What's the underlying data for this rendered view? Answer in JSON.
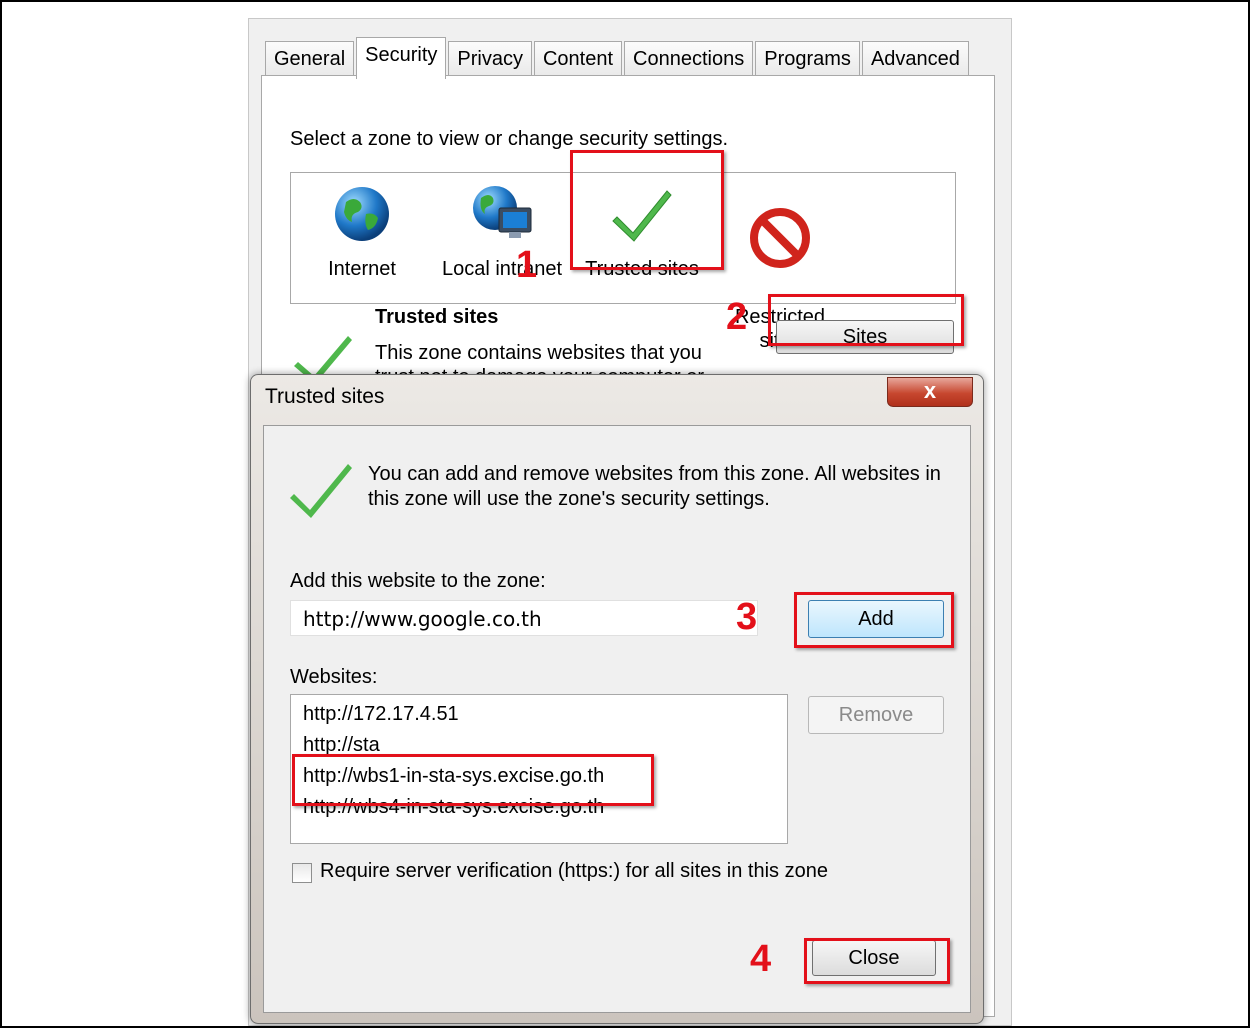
{
  "options_dialog": {
    "tabs": [
      "General",
      "Security",
      "Privacy",
      "Content",
      "Connections",
      "Programs",
      "Advanced"
    ],
    "active_tab": "Security",
    "zone_prompt": "Select a zone to view or change security settings.",
    "zones": [
      {
        "label": "Internet",
        "icon": "globe-icon"
      },
      {
        "label": "Local intranet",
        "icon": "intranet-icon"
      },
      {
        "label": "Trusted sites",
        "icon": "checkmark-icon"
      },
      {
        "label": "Restricted\nsites",
        "icon": "restricted-icon"
      }
    ],
    "zone_title": "Trusted sites",
    "zone_description_line1": "This zone contains websites that you",
    "zone_description_line2": "trust not to damage your computer or",
    "sites_button": "Sites"
  },
  "trusted_dialog": {
    "title": "Trusted sites",
    "close_glyph": "x",
    "info_text": "You can add and remove websites from this zone. All websites in this zone will use the zone's security settings.",
    "add_label": "Add this website to the zone:",
    "add_value": "http://www.google.co.th",
    "add_button": "Add",
    "websites_label": "Websites:",
    "websites": [
      "http://172.17.4.51",
      "http://sta",
      "http://wbs1-in-sta-sys.excise.go.th",
      "http://wbs4-in-sta-sys.excise.go.th"
    ],
    "remove_button": "Remove",
    "require_https_label": "Require server verification (https:) for all sites in this zone",
    "require_https_checked": false,
    "close_button": "Close"
  },
  "annotations": {
    "step1": "1",
    "step2": "2",
    "step3": "3",
    "step4": "4",
    "highlight_color": "#e3101a"
  }
}
